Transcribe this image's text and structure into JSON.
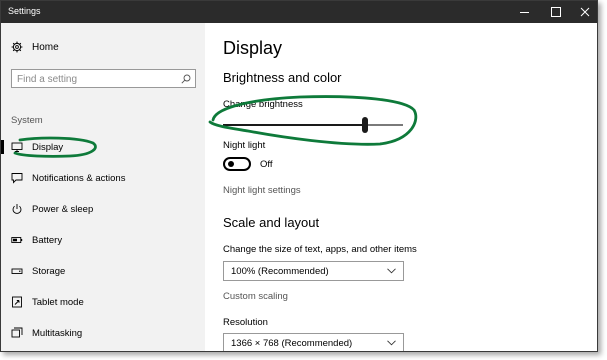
{
  "window": {
    "title": "Settings"
  },
  "sidebar": {
    "home_label": "Home",
    "search_placeholder": "Find a setting",
    "section_label": "System",
    "items": [
      {
        "label": "Display",
        "icon": "monitor-icon",
        "selected": true
      },
      {
        "label": "Notifications & actions",
        "icon": "notification-icon"
      },
      {
        "label": "Power & sleep",
        "icon": "power-icon"
      },
      {
        "label": "Battery",
        "icon": "battery-icon"
      },
      {
        "label": "Storage",
        "icon": "storage-icon"
      },
      {
        "label": "Tablet mode",
        "icon": "tablet-mode-icon"
      },
      {
        "label": "Multitasking",
        "icon": "multitasking-icon"
      }
    ]
  },
  "main": {
    "title": "Display",
    "brightness_section": "Brightness and color",
    "brightness_label": "Change brightness",
    "brightness_value": 80,
    "night_light_label": "Night light",
    "night_light_state": "Off",
    "night_light_settings": "Night light settings",
    "scale_section": "Scale and layout",
    "scale_label": "Change the size of text, apps, and other items",
    "scale_value": "100% (Recommended)",
    "custom_scaling": "Custom scaling",
    "resolution_label": "Resolution",
    "resolution_value": "1366 × 768 (Recommended)"
  },
  "colors": {
    "annotation": "#0e7a3a",
    "titlebar": "#2b2b2b",
    "sidebar_bg": "#f2f2f2"
  }
}
